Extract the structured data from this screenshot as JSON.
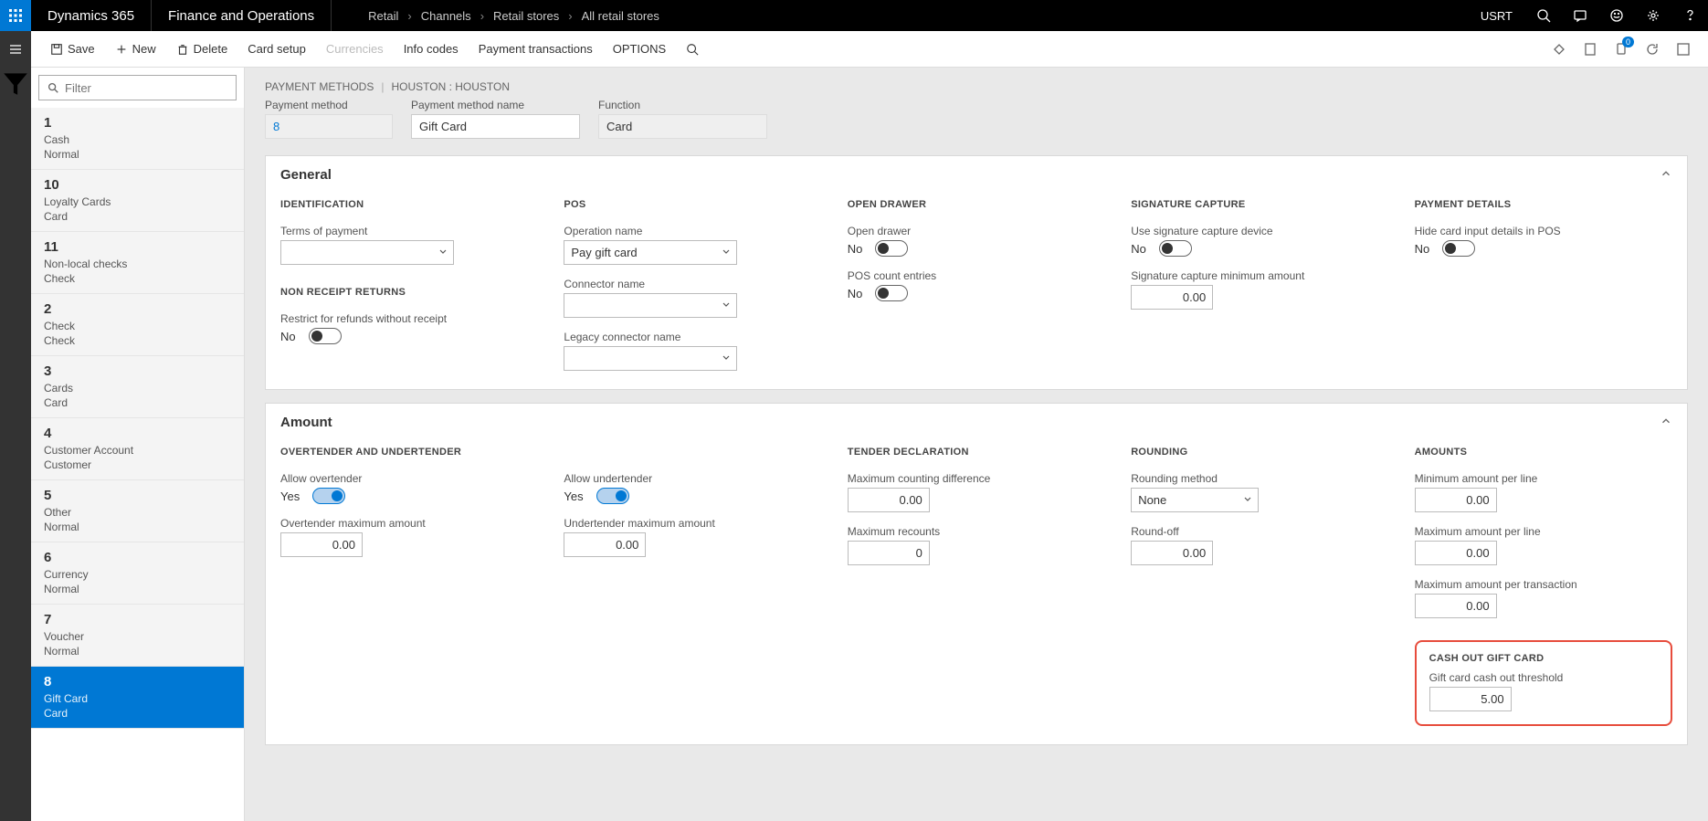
{
  "top": {
    "brand": "Dynamics 365",
    "app": "Finance and Operations",
    "bc": [
      "Retail",
      "Channels",
      "Retail stores",
      "All retail stores"
    ],
    "user": "USRT"
  },
  "actions": {
    "save": "Save",
    "new": "New",
    "delete": "Delete",
    "card_setup": "Card setup",
    "currencies": "Currencies",
    "info_codes": "Info codes",
    "payment_transactions": "Payment transactions",
    "options": "OPTIONS",
    "badge": "0"
  },
  "filter_placeholder": "Filter",
  "sidebar": [
    {
      "num": "1",
      "l2": "Cash",
      "l3": "Normal"
    },
    {
      "num": "10",
      "l2": "Loyalty Cards",
      "l3": "Card"
    },
    {
      "num": "11",
      "l2": "Non-local checks",
      "l3": "Check"
    },
    {
      "num": "2",
      "l2": "Check",
      "l3": "Check"
    },
    {
      "num": "3",
      "l2": "Cards",
      "l3": "Card"
    },
    {
      "num": "4",
      "l2": "Customer Account",
      "l3": "Customer"
    },
    {
      "num": "5",
      "l2": "Other",
      "l3": "Normal"
    },
    {
      "num": "6",
      "l2": "Currency",
      "l3": "Normal"
    },
    {
      "num": "7",
      "l2": "Voucher",
      "l3": "Normal"
    },
    {
      "num": "8",
      "l2": "Gift Card",
      "l3": "Card"
    }
  ],
  "header": {
    "crumb1": "PAYMENT METHODS",
    "crumb2": "HOUSTON : HOUSTON",
    "pm_label": "Payment method",
    "pm_value": "8",
    "pmn_label": "Payment method name",
    "pmn_value": "Gift Card",
    "fn_label": "Function",
    "fn_value": "Card"
  },
  "general": {
    "title": "General",
    "identification": "IDENTIFICATION",
    "terms": "Terms of payment",
    "non_receipt": "NON RECEIPT RETURNS",
    "restrict": "Restrict for refunds without receipt",
    "restrict_val": "No",
    "pos": "POS",
    "op_name": "Operation name",
    "op_val": "Pay gift card",
    "conn_name": "Connector name",
    "legacy_conn": "Legacy connector name",
    "open_drawer_h": "OPEN DRAWER",
    "open_drawer": "Open drawer",
    "open_drawer_val": "No",
    "pos_count": "POS count entries",
    "pos_count_val": "No",
    "sig_h": "SIGNATURE CAPTURE",
    "sig_dev": "Use signature capture device",
    "sig_dev_val": "No",
    "sig_min": "Signature capture minimum amount",
    "sig_min_val": "0.00",
    "pd_h": "PAYMENT DETAILS",
    "hide_card": "Hide card input details in POS",
    "hide_card_val": "No"
  },
  "amount": {
    "title": "Amount",
    "ot_h": "OVERTENDER AND UNDERTENDER",
    "allow_ot": "Allow overtender",
    "allow_ot_val": "Yes",
    "ot_max": "Overtender maximum amount",
    "ot_max_val": "0.00",
    "allow_ut": "Allow undertender",
    "allow_ut_val": "Yes",
    "ut_max": "Undertender maximum amount",
    "ut_max_val": "0.00",
    "td_h": "TENDER DECLARATION",
    "max_cd": "Maximum counting difference",
    "max_cd_val": "0.00",
    "max_rc": "Maximum recounts",
    "max_rc_val": "0",
    "rd_h": "ROUNDING",
    "rd_method": "Rounding method",
    "rd_method_val": "None",
    "round_off": "Round-off",
    "round_off_val": "0.00",
    "am_h": "AMOUNTS",
    "min_line": "Minimum amount per line",
    "min_line_val": "0.00",
    "max_line": "Maximum amount per line",
    "max_line_val": "0.00",
    "max_tx": "Maximum amount per transaction",
    "max_tx_val": "0.00",
    "cash_h": "CASH OUT GIFT CARD",
    "cash_th": "Gift card cash out threshold",
    "cash_th_val": "5.00"
  }
}
